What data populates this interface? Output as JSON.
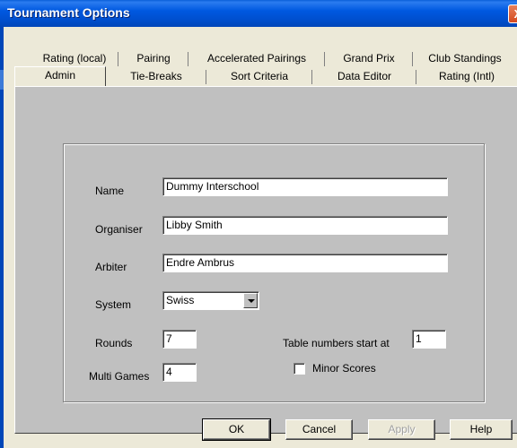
{
  "window": {
    "title": "Tournament Options",
    "close_glyph": "X"
  },
  "tabs_row1": [
    {
      "label": "Rating (local)"
    },
    {
      "label": "Pairing"
    },
    {
      "label": "Accelerated Pairings"
    },
    {
      "label": "Grand Prix"
    },
    {
      "label": "Club Standings"
    }
  ],
  "tabs_row2": [
    {
      "label": "Admin",
      "active": true
    },
    {
      "label": "Tie-Breaks"
    },
    {
      "label": "Sort Criteria"
    },
    {
      "label": "Data Editor"
    },
    {
      "label": "Rating (Intl)"
    }
  ],
  "form": {
    "name_label": "Name",
    "name_value": "Dummy Interschool",
    "organiser_label": "Organiser",
    "organiser_value": "Libby Smith",
    "arbiter_label": "Arbiter",
    "arbiter_value": "Endre Ambrus",
    "system_label": "System",
    "system_value": "Swiss",
    "rounds_label": "Rounds",
    "rounds_value": "7",
    "multi_games_label": "Multi Games",
    "multi_games_value": "4",
    "table_numbers_label": "Table numbers start at",
    "table_numbers_value": "1",
    "minor_scores_label": "Minor Scores",
    "minor_scores_checked": false
  },
  "buttons": {
    "ok": "OK",
    "cancel": "Cancel",
    "apply": "Apply",
    "help": "Help"
  },
  "colors": {
    "titlebar": "#0058e0",
    "panel": "#c0c0c0",
    "dialog": "#ece9d8"
  }
}
